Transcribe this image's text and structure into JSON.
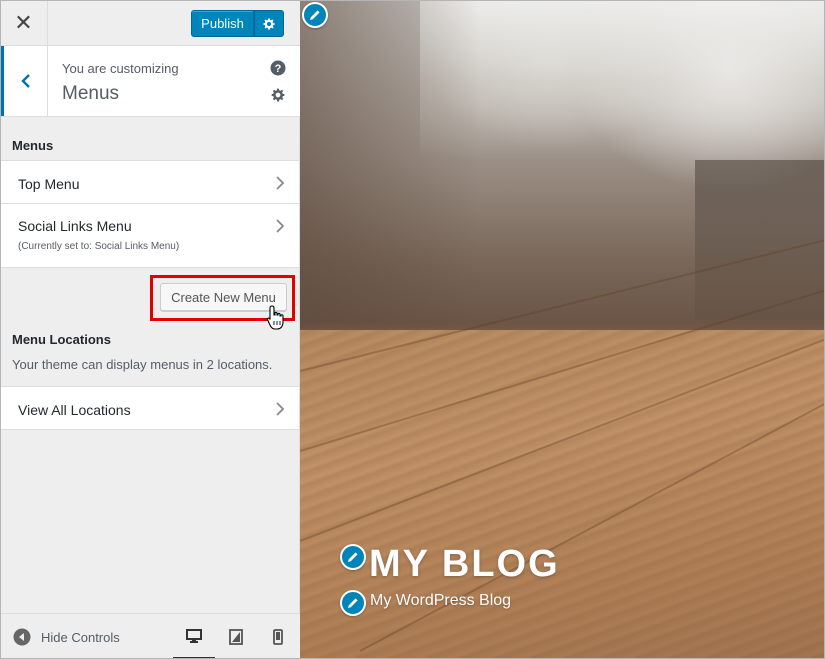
{
  "header": {
    "close_label": "✕",
    "publish_label": "Publish"
  },
  "info": {
    "customizing_label": "You are customizing",
    "panel_title": "Menus"
  },
  "menus_section": {
    "heading": "Menus",
    "items": [
      {
        "label": "Top Menu"
      },
      {
        "label": "Social Links Menu",
        "sublabel": "(Currently set to: Social Links Menu)"
      }
    ],
    "create_button": "Create New Menu"
  },
  "locations_section": {
    "heading": "Menu Locations",
    "description": "Your theme can display menus in 2 locations.",
    "view_all_label": "View All Locations"
  },
  "footer": {
    "hide_controls_label": "Hide Controls",
    "active_device": "desktop"
  },
  "preview": {
    "site_title": "MY BLOG",
    "tagline": "My WordPress Blog"
  },
  "colors": {
    "accent": "#0085ba",
    "accent_border": "#0073aa",
    "highlight": "#e00000",
    "sidebar_bg": "#eeeeee"
  },
  "icons": {
    "close": "close-icon",
    "settings": "gear-icon",
    "back": "chevron-left-icon",
    "help": "help-icon",
    "chevron": "chevron-right-icon",
    "edit": "pencil-icon",
    "collapse": "collapse-arrow-icon",
    "desktop": "desktop-icon",
    "tablet": "tablet-icon",
    "mobile": "mobile-icon",
    "cursor": "hand-cursor-icon"
  }
}
